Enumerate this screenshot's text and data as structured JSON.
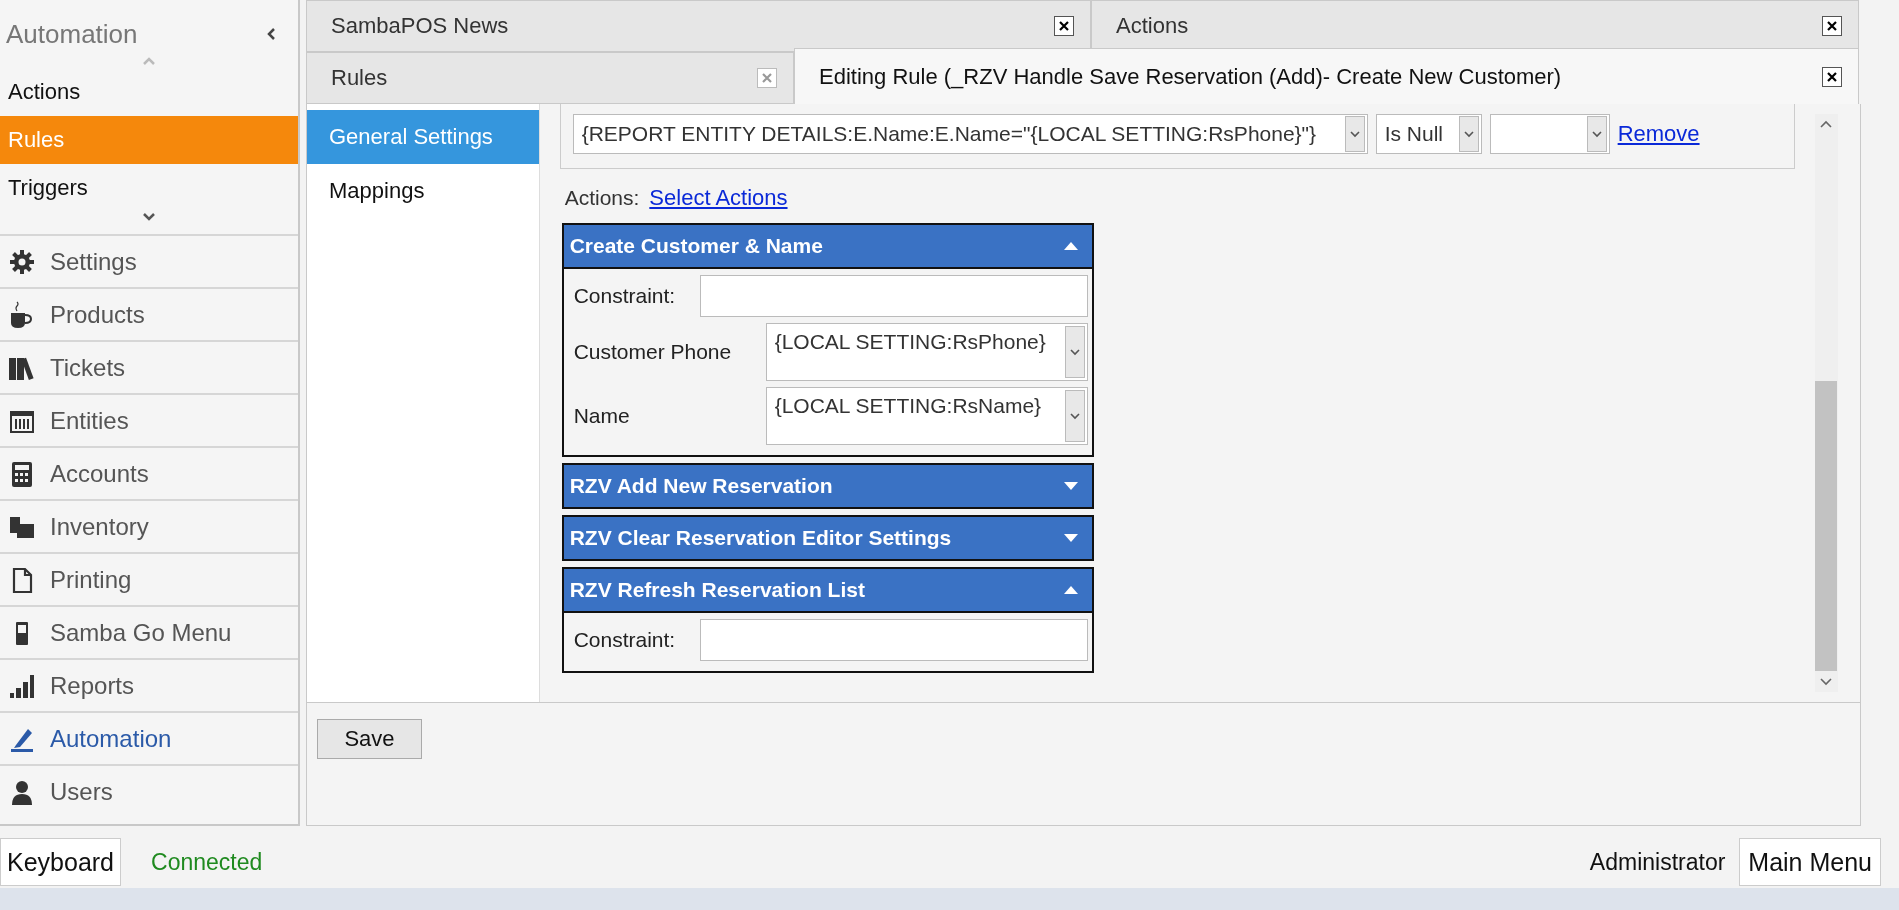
{
  "sidebar": {
    "title": "Automation",
    "submenu": [
      {
        "label": "Actions",
        "selected": false
      },
      {
        "label": "Rules",
        "selected": true
      },
      {
        "label": "Triggers",
        "selected": false
      }
    ],
    "nav": [
      {
        "label": "Settings",
        "selected": false
      },
      {
        "label": "Products",
        "selected": false
      },
      {
        "label": "Tickets",
        "selected": false
      },
      {
        "label": "Entities",
        "selected": false
      },
      {
        "label": "Accounts",
        "selected": false
      },
      {
        "label": "Inventory",
        "selected": false
      },
      {
        "label": "Printing",
        "selected": false
      },
      {
        "label": "Samba Go Menu",
        "selected": false
      },
      {
        "label": "Reports",
        "selected": false
      },
      {
        "label": "Automation",
        "selected": true
      },
      {
        "label": "Users",
        "selected": false
      }
    ]
  },
  "tab_rows": [
    [
      {
        "label": "SambaPOS News",
        "selected": false
      },
      {
        "label": "Actions",
        "selected": false
      }
    ],
    [
      {
        "label": "Rules",
        "selected": false
      },
      {
        "label": "Editing Rule (_RZV Handle Save Reservation (Add)- Create New Customer)",
        "selected": true
      }
    ]
  ],
  "editor": {
    "nav": [
      {
        "label": "General Settings",
        "selected": true
      },
      {
        "label": "Mappings",
        "selected": false
      }
    ],
    "condition": {
      "expression": "{REPORT ENTITY DETAILS:E.Name:E.Name=\"{LOCAL SETTING:RsPhone}\"}",
      "operator": "Is Null",
      "remove_link": "Remove"
    },
    "actions_label": "Actions:",
    "select_link": "Select Actions",
    "actions": [
      {
        "name": "Create Customer & Name",
        "expanded": true,
        "fields": [
          {
            "label": "Constraint:",
            "kind": "text"
          },
          {
            "label": "Customer Phone",
            "kind": "dropdown",
            "value": "{LOCAL SETTING:RsPhone}"
          },
          {
            "label": "Name",
            "kind": "dropdown",
            "value": "{LOCAL SETTING:RsName}"
          }
        ]
      },
      {
        "name": "RZV Add New Reservation",
        "expanded": false
      },
      {
        "name": "RZV Clear Reservation Editor Settings",
        "expanded": false
      },
      {
        "name": "RZV Refresh Reservation List",
        "expanded": true,
        "fields": [
          {
            "label": "Constraint:",
            "kind": "text"
          }
        ]
      }
    ],
    "save": "Save"
  },
  "status_bar": {
    "keyboard": "Keyboard",
    "connection": "Connected",
    "user": "Administrator",
    "main_menu": "Main Menu"
  }
}
